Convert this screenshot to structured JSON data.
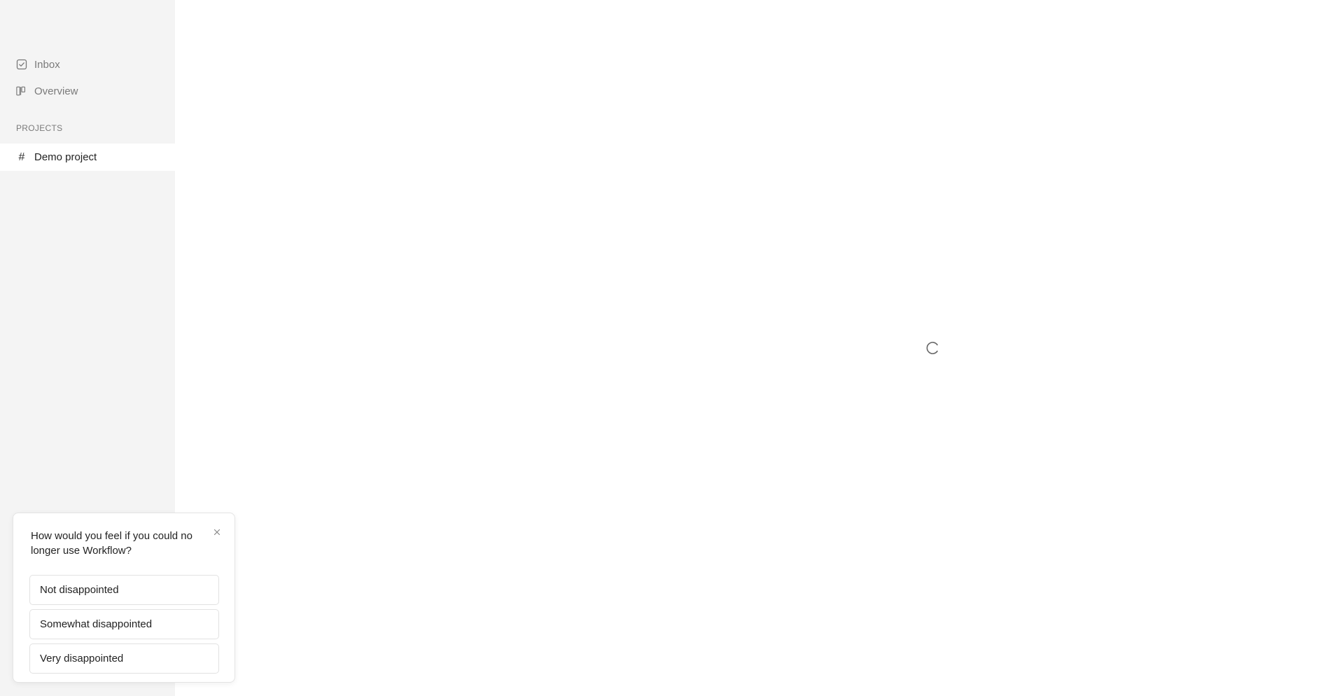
{
  "sidebar": {
    "nav_items": [
      {
        "label": "Inbox",
        "icon": "inbox-check-icon"
      },
      {
        "label": "Overview",
        "icon": "board-columns-icon"
      }
    ],
    "projects_heading": "PROJECTS",
    "projects": [
      {
        "label": "Demo project",
        "icon": "hash-icon",
        "active": true
      }
    ]
  },
  "main": {
    "status": "loading",
    "spinner_icon": "loading-spinner-icon"
  },
  "survey": {
    "question": "How would you feel if you could no longer use Workflow?",
    "close_icon": "close-icon",
    "options": [
      {
        "label": "Not disappointed"
      },
      {
        "label": "Somewhat disappointed"
      },
      {
        "label": "Very disappointed"
      }
    ]
  },
  "colors": {
    "sidebar_bg": "#f4f4f4",
    "active_item_bg": "#ffffff",
    "muted_text": "#7a7a7a",
    "primary_text": "#222222",
    "border": "#e2e2e2"
  }
}
